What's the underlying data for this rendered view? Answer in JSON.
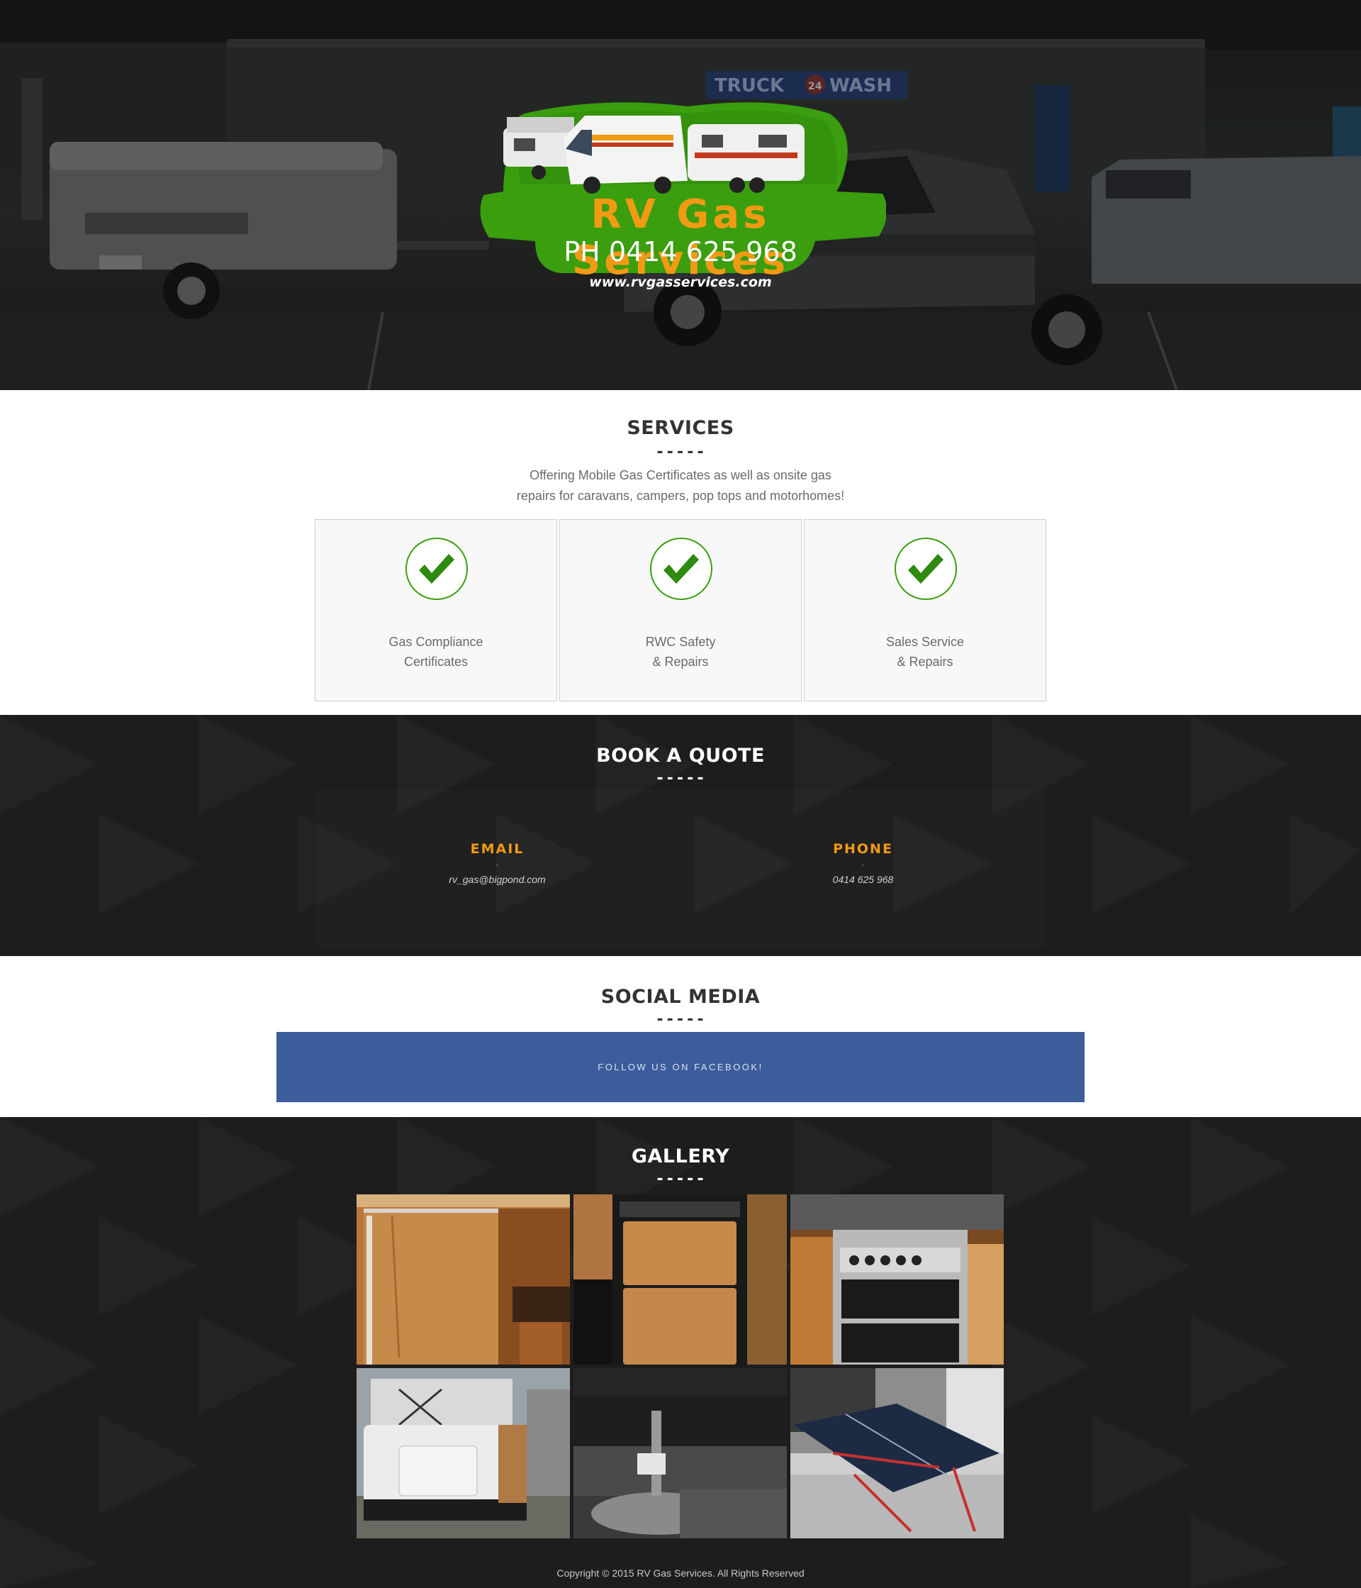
{
  "hero": {
    "logo_title": "RV Gas Services",
    "logo_phone": "PH 0414 625 968",
    "logo_url": "www.rvgasservices.com",
    "sign_text": "TRUCK",
    "sign_text_2": "WASH",
    "sign_badge": "24"
  },
  "services": {
    "title": "SERVICES",
    "divider": "-----",
    "description_line1": "Offering Mobile Gas Certificates as well as onsite gas",
    "description_line2": "repairs for caravans, campers, pop tops and motorhomes!",
    "items": [
      {
        "line1": "Gas Compliance",
        "line2": "Certificates",
        "icon": "checkmark-icon"
      },
      {
        "line1": "RWC Safety",
        "line2": "& Repairs",
        "icon": "checkmark-icon"
      },
      {
        "line1": "Sales Service",
        "line2": "& Repairs",
        "icon": "checkmark-icon"
      }
    ]
  },
  "quote": {
    "title": "BOOK A QUOTE",
    "divider": "-----",
    "email_label": "EMAIL",
    "email_sep": "-",
    "email_value": "rv_gas@bigpond.com",
    "phone_label": "PHONE",
    "phone_sep": "-",
    "phone_value": "0414 625 968"
  },
  "social": {
    "title": "SOCIAL MEDIA",
    "divider": "-----",
    "facebook_label": "FOLLOW US ON FACEBOOK!"
  },
  "gallery": {
    "title": "GALLERY",
    "divider": "-----",
    "images": [
      "fridge-photo",
      "refrigerator-photo",
      "oven-photo",
      "camper-trailer-photo",
      "gas-cylinder-photo",
      "solar-panel-photo"
    ]
  },
  "footer": {
    "copyright": "Copyright © 2015 RV Gas Services. All Rights Reserved"
  },
  "colors": {
    "accent_orange": "#f39a14",
    "logo_green": "#3a9e0f",
    "check_green": "#2f8a10",
    "facebook_blue": "#3c5c9b",
    "dark_bg": "#1d1d1d"
  }
}
